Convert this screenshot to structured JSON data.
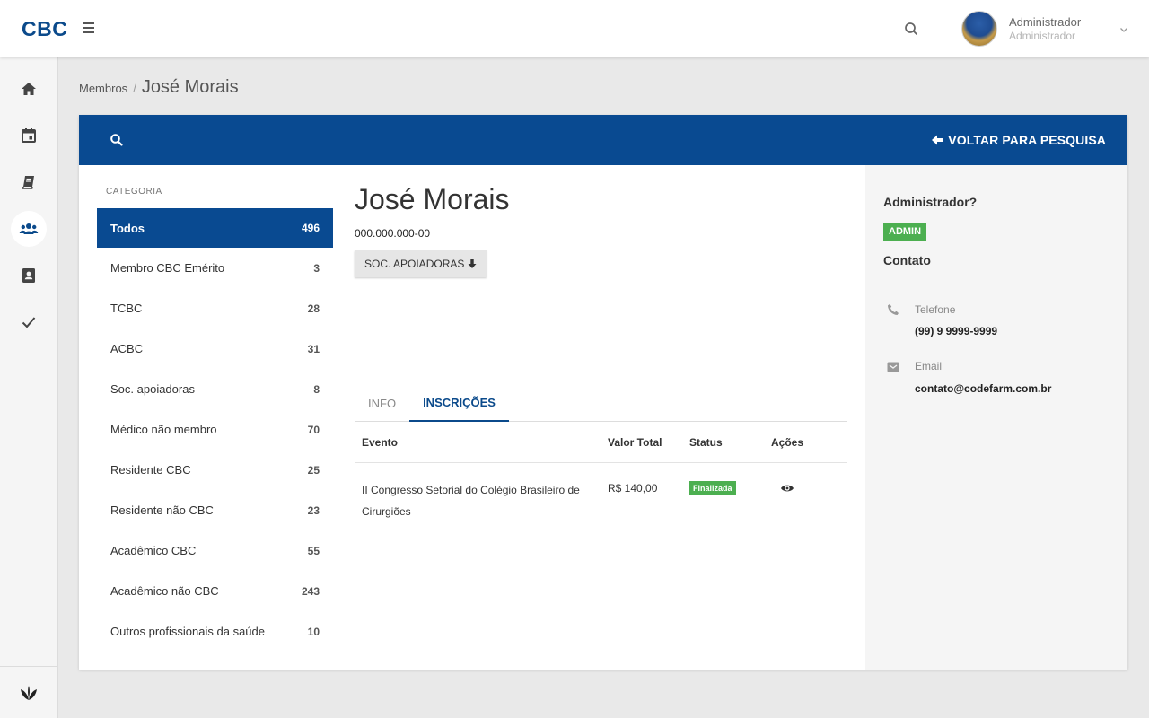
{
  "app": {
    "logo": "CBC"
  },
  "user": {
    "name": "Administrador",
    "role": "Administrador"
  },
  "breadcrumb": {
    "parent": "Membros",
    "separator": "/",
    "current": "José Morais"
  },
  "header": {
    "back_label": "VOLTAR PARA PESQUISA"
  },
  "categories": {
    "title": "CATEGORIA",
    "items": [
      {
        "label": "Todos",
        "count": "496",
        "active": true
      },
      {
        "label": "Membro CBC Emérito",
        "count": "3"
      },
      {
        "label": "TCBC",
        "count": "28"
      },
      {
        "label": "ACBC",
        "count": "31"
      },
      {
        "label": "Soc. apoiadoras",
        "count": "8"
      },
      {
        "label": "Médico não membro",
        "count": "70"
      },
      {
        "label": "Residente CBC",
        "count": "25"
      },
      {
        "label": "Residente não CBC",
        "count": "23"
      },
      {
        "label": "Acadêmico CBC",
        "count": "55"
      },
      {
        "label": "Acadêmico não CBC",
        "count": "243"
      },
      {
        "label": "Outros profissionais da saúde",
        "count": "10"
      }
    ]
  },
  "profile": {
    "name": "José Morais",
    "cpf": "000.000.000-00",
    "group_button": "SOC. APOIADORAS"
  },
  "tabs": [
    {
      "label": "INFO"
    },
    {
      "label": "INSCRIÇÕES",
      "active": true
    }
  ],
  "table": {
    "headers": [
      "Evento",
      "Valor Total",
      "Status",
      "Ações"
    ],
    "rows": [
      {
        "evento": "II Congresso Setorial do Colégio Brasileiro de Cirurgiões",
        "valor": "R$ 140,00",
        "status": "Finalizada",
        "action_icon": "eye-icon"
      }
    ]
  },
  "sidepanel": {
    "admin_question": "Administrador?",
    "admin_badge": "ADMIN",
    "contact_title": "Contato",
    "phone_label": "Telefone",
    "phone_value": "(99) 9 9999-9999",
    "email_label": "Email",
    "email_value": "contato@codefarm.com.br"
  },
  "colors": {
    "primary": "#094a91",
    "success": "#4caf50",
    "logo": "#0b4a8b"
  },
  "icons": [
    "menu-icon",
    "search-icon",
    "chevron-down-icon",
    "home-icon",
    "calendar-icon",
    "book-icon",
    "members-icon",
    "contact-card-icon",
    "check-icon",
    "leaf-logo-icon",
    "arrow-left-icon",
    "arrow-down-icon",
    "phone-icon",
    "email-icon",
    "eye-icon"
  ]
}
